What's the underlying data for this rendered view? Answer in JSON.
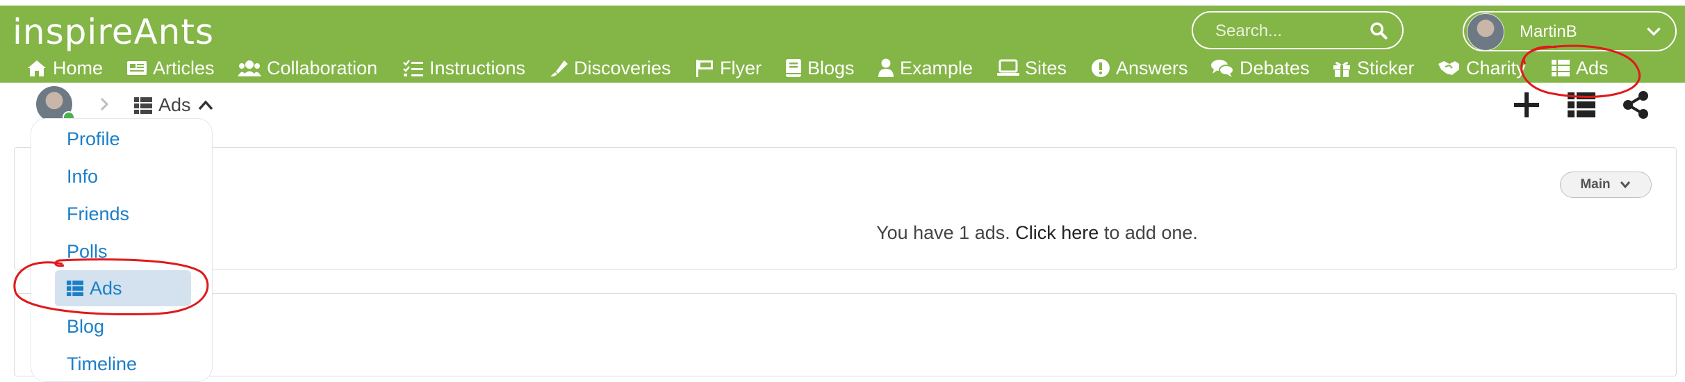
{
  "brand": {
    "logo_text": "inspireAnts"
  },
  "search": {
    "placeholder": "Search..."
  },
  "user": {
    "name": "MartinB"
  },
  "nav": [
    {
      "label": "Home",
      "icon": "home-icon"
    },
    {
      "label": "Articles",
      "icon": "newspaper-icon"
    },
    {
      "label": "Collaboration",
      "icon": "users-icon"
    },
    {
      "label": "Instructions",
      "icon": "tasks-icon"
    },
    {
      "label": "Discoveries",
      "icon": "highlighter-icon"
    },
    {
      "label": "Flyer",
      "icon": "flag-icon"
    },
    {
      "label": "Blogs",
      "icon": "book-icon"
    },
    {
      "label": "Example",
      "icon": "user-icon"
    },
    {
      "label": "Sites",
      "icon": "laptop-icon"
    },
    {
      "label": "Answers",
      "icon": "exclamation-circle-icon"
    },
    {
      "label": "Debates",
      "icon": "comments-icon"
    },
    {
      "label": "Sticker",
      "icon": "gift-icon"
    },
    {
      "label": "Charity",
      "icon": "handshake-icon"
    },
    {
      "label": "Ads",
      "icon": "list-icon"
    }
  ],
  "breadcrumb": {
    "current": "Ads"
  },
  "profile_menu": {
    "items": [
      "Profile",
      "Info",
      "Friends",
      "Polls",
      "Ads",
      "Blog",
      "Timeline"
    ],
    "active": "Ads"
  },
  "ads_panel": {
    "filter_label": "Main",
    "message_prefix": "You have 1 ads.",
    "message_link": "Click here",
    "message_suffix": "to add one."
  },
  "colors": {
    "brand_green": "#84b547",
    "link_blue": "#1a7ec9",
    "active_bg": "#d3e2ee",
    "annotation_red": "#e0191b"
  }
}
